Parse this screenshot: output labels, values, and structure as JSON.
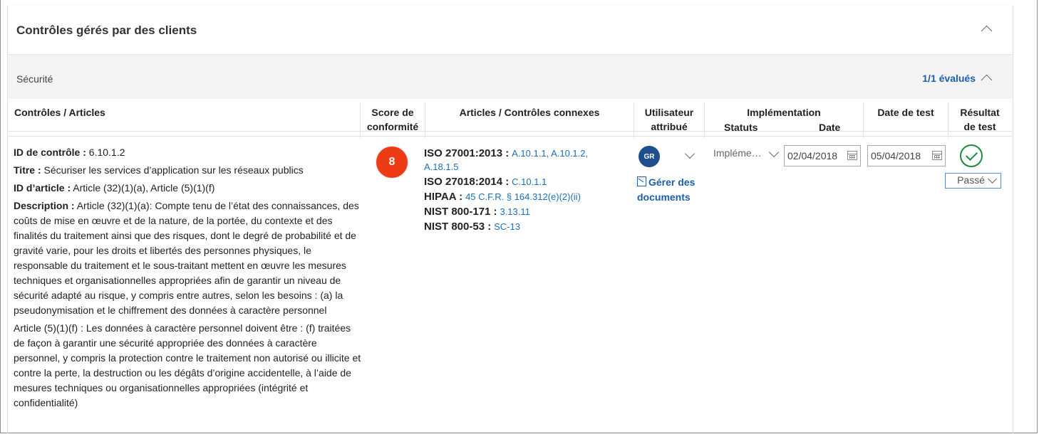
{
  "panel": {
    "title": "Contrôles gérés par des clients"
  },
  "section": {
    "label": "Sécurité",
    "evaluated": "1/1 évalués"
  },
  "columns": {
    "controls": "Contrôles / Articles",
    "score_l1": "Score de",
    "score_l2": "conformité",
    "related": "Articles / Contrôles connexes",
    "user_l1": "Utilisateur",
    "user_l2": "attribué",
    "impl": "Implémentation",
    "impl_status": "Statuts",
    "impl_date": "Date",
    "test_date": "Date de test",
    "result_l1": "Résultat",
    "result_l2": "de test"
  },
  "row": {
    "control_id_label": "ID de contrôle :",
    "control_id": "6.10.1.2",
    "title_label": "Titre :",
    "title": "Sécuriser les services d’application sur les réseaux publics",
    "article_id_label": "ID d’article :",
    "article_id": "Article (32)(1)(a), Article (5)(1)(f)",
    "description_label": "Description :",
    "description_1": "Article (32)(1)(a): Compte tenu de l’état des connaissances, des coûts de mise en œuvre et de la nature, de la portée, du contexte et des finalités du traitement ainsi que des risques, dont le degré de probabilité et de gravité varie, pour les droits et libertés des personnes physiques, le responsable du traitement et le sous-traitant mettent en œuvre les mesures techniques et organisationnelles appropriées afin de garantir un niveau de sécurité adapté au risque, y compris entre autres, selon les besoins : (a) la pseudonymisation et le chiffrement des données à caractère personnel",
    "description_2": "Article (5)(1)(f) : Les données à caractère personnel doivent être : (f) traitées de façon à garantir une sécurité appropriée des données à caractère personnel, y compris la protection contre le traitement non autorisé ou illicite et contre la perte, la destruction ou les dégâts d’origine accidentelle, à l’aide de mesures techniques ou organisationnelles appropriées (intégrité et confidentialité)",
    "score": "8",
    "related": [
      {
        "std": "ISO 27001:2013 :",
        "refs": "A.10.1.1, A.10.1.2, A.18.1.5"
      },
      {
        "std": "ISO 27018:2014 :",
        "refs": "C.10.1.1"
      },
      {
        "std": "HIPAA :",
        "refs": "45 C.F.R. § 164.312(e)(2)(ii)"
      },
      {
        "std": "NIST 800-171 :",
        "refs": "3.13.11"
      },
      {
        "std": "NIST 800-53 :",
        "refs": "SC-13"
      }
    ],
    "user_initials": "GR",
    "manage_docs": "Gérer des documents",
    "impl_status": "Impléme…",
    "impl_date": "02/04/2018",
    "test_date": "05/04/2018",
    "result": "Passé"
  },
  "colors": {
    "score": "#ec3b15",
    "link": "#1a5fa8",
    "pass": "#1f8a3c",
    "avatar": "#1f4e8c"
  },
  "icons": [
    "chevron-up-icon",
    "chevron-down-icon",
    "document-icon",
    "calendar-icon",
    "check-circle-icon"
  ]
}
